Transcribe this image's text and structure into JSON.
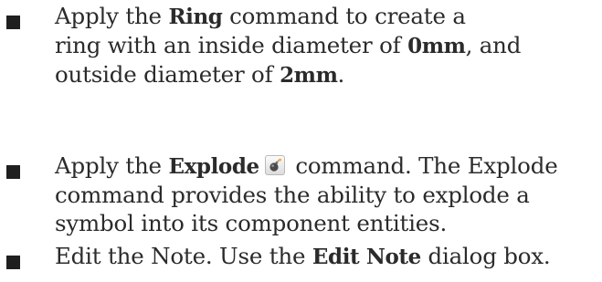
{
  "bullets": [
    {
      "lines": [
        {
          "segments": [
            {
              "text": "Apply the ",
              "bold": false
            },
            {
              "text": "Ring",
              "bold": true
            },
            {
              "text": " command to create a",
              "bold": false
            }
          ]
        },
        {
          "segments": [
            {
              "text": "ring with an inside diameter of ",
              "bold": false
            },
            {
              "text": "0mm",
              "bold": true
            },
            {
              "text": ", and",
              "bold": false
            }
          ]
        },
        {
          "segments": [
            {
              "text": "outside diameter of ",
              "bold": false
            },
            {
              "text": "2mm",
              "bold": true
            },
            {
              "text": ".",
              "bold": false
            }
          ]
        }
      ]
    },
    {
      "lines": [
        {
          "segments": [
            {
              "text": "Apply the ",
              "bold": false
            },
            {
              "text": "Explode",
              "bold": true
            },
            {
              "icon": "explode-bomb-icon"
            },
            {
              "text": " command. The Explode",
              "bold": false
            }
          ]
        },
        {
          "segments": [
            {
              "text": "command provides the ability to explode a",
              "bold": false
            }
          ]
        },
        {
          "segments": [
            {
              "text": "symbol into its component entities.",
              "bold": false
            }
          ]
        }
      ]
    },
    {
      "lines": [
        {
          "segments": [
            {
              "text": "Edit the Note. Use the ",
              "bold": false
            },
            {
              "text": "Edit Note",
              "bold": true
            },
            {
              "text": " dialog box.",
              "bold": false
            }
          ]
        }
      ]
    }
  ]
}
